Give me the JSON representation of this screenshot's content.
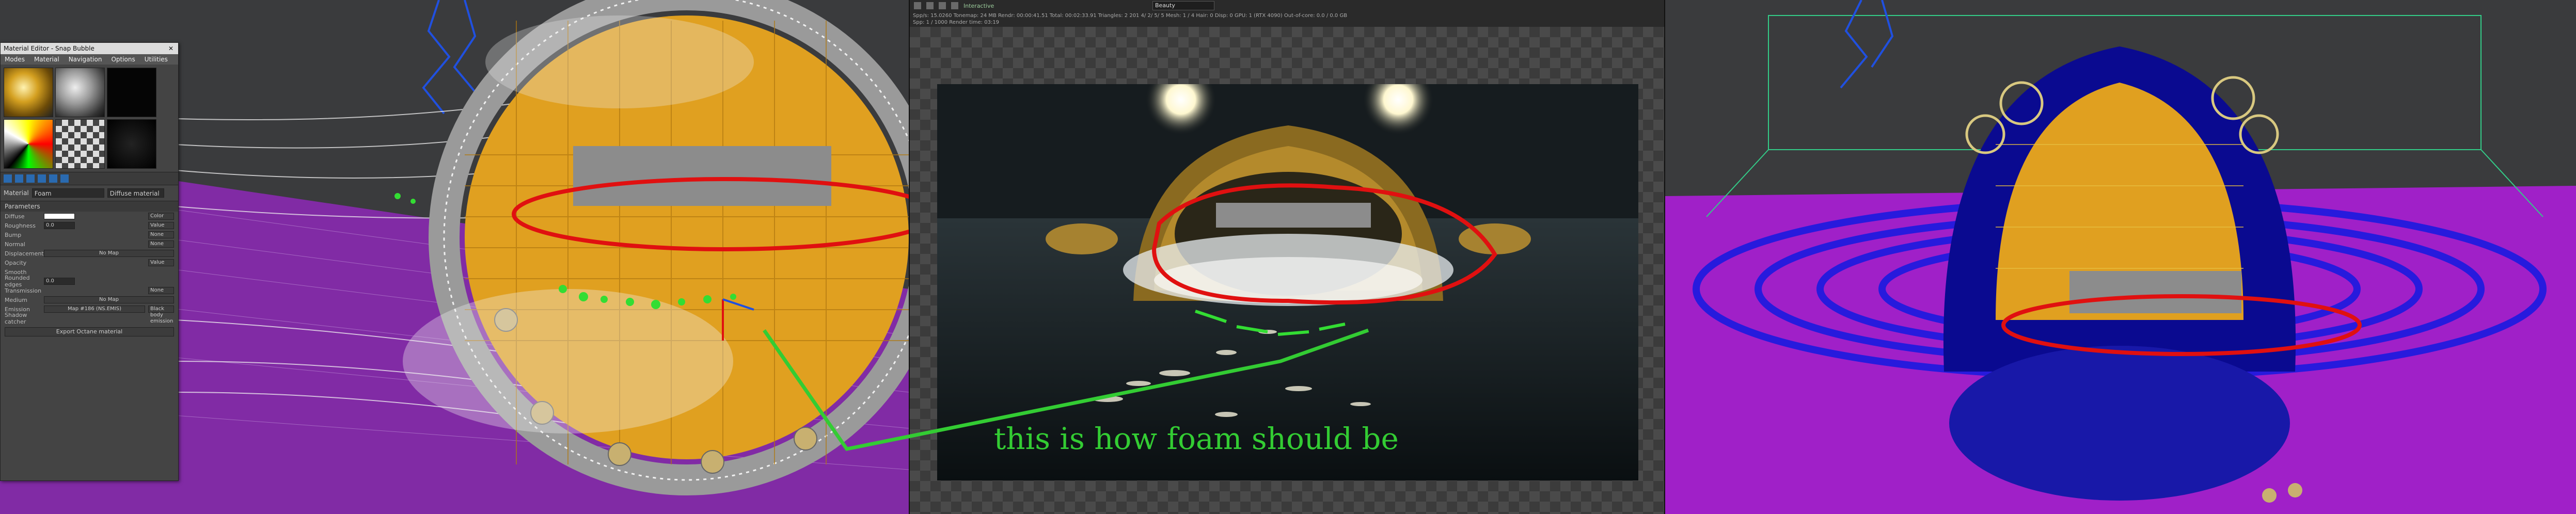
{
  "material_editor": {
    "title": "Material Editor - Snap Bubble",
    "menu": [
      "Modes",
      "Material",
      "Navigation",
      "Options",
      "Utilities"
    ],
    "material_label": "Material",
    "material_name": "Foam",
    "material_type": "Diffuse material",
    "sections": {
      "parameters": "Parameters"
    },
    "params": [
      {
        "label": "Diffuse",
        "value": "",
        "map": "",
        "unit": "Color"
      },
      {
        "label": "Roughness",
        "value": "0.0",
        "map": "",
        "unit": "Value"
      },
      {
        "label": "Bump",
        "value": "",
        "map": "",
        "unit": "None"
      },
      {
        "label": "Normal",
        "value": "",
        "map": "",
        "unit": "None"
      },
      {
        "label": "Displacement",
        "value": "",
        "map": "No Map",
        "unit": ""
      },
      {
        "label": "Opacity",
        "value": "",
        "map": "",
        "unit": "Value"
      },
      {
        "label": "Smooth",
        "value": "",
        "map": "",
        "unit": ""
      },
      {
        "label": "Rounded edges",
        "value": "0.0",
        "map": "",
        "unit": ""
      },
      {
        "label": "Transmission",
        "value": "",
        "map": "",
        "unit": "None"
      },
      {
        "label": "Medium",
        "value": "",
        "map": "No Map",
        "unit": ""
      },
      {
        "label": "Emission",
        "value": "",
        "map": "Map #186 (NS.EMIS)",
        "unit": "Black body emission"
      },
      {
        "label": "Shadow catcher",
        "value": "",
        "map": "",
        "unit": ""
      }
    ],
    "export_button": "Export Octane material"
  },
  "render_view": {
    "topbar_status": "Interactive",
    "view_select": "Beauty",
    "stats_line1": "Spp/s: 15.0260   Tonemap: 24 MB   Rendr: 00:00:41.51   Total: 00:02:33.91   Triangles: 2 201 4/ 2/ 5/ 5   Mesh: 1 / 4   Hair: 0   Disp: 0   GPU: 1 (RTX 4090)   Out-of-core: 0.0 / 0.0 GB",
    "stats_line2": "Spp: 1 / 1000   Render time: 03:19"
  },
  "annotation": {
    "text": "this is how foam should be",
    "line_color": "#33cc33",
    "circle_color": "#e01010"
  },
  "colors": {
    "viewport_bg": "#3a3b3d",
    "mesh_orange": "#e0a020",
    "ground_purple": "#8a2ab0",
    "particle_blue": "#1a1ae0",
    "foam_white": "#f0f0f0",
    "redaction_grey": "#8c8c8c"
  }
}
